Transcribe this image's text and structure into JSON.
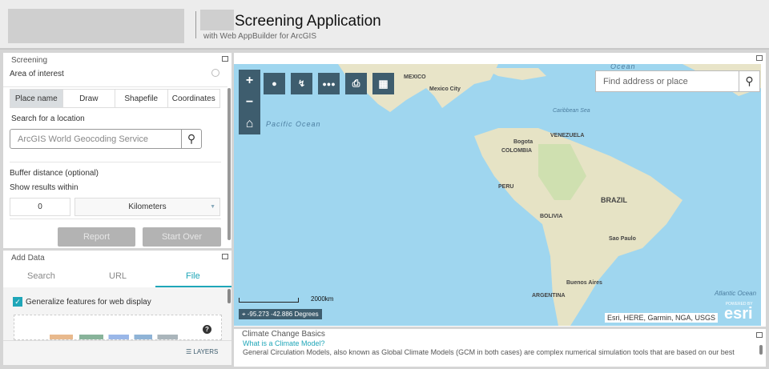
{
  "header": {
    "title": "Screening Application",
    "subtitle": "with Web AppBuilder for ArcGIS"
  },
  "screening": {
    "title": "Screening",
    "area_label": "Area of interest",
    "tabs": [
      "Place name",
      "Draw",
      "Shapefile",
      "Coordinates"
    ],
    "search_label": "Search for a location",
    "search_placeholder": "ArcGIS World Geocoding Service",
    "buffer_label": "Buffer distance (optional)",
    "within_label": "Show results within",
    "distance_value": "0",
    "unit": "Kilometers",
    "report": "Report",
    "start_over": "Start Over"
  },
  "add_data": {
    "title": "Add Data",
    "tabs": [
      "Search",
      "URL",
      "File"
    ],
    "generalize": "Generalize features for web display",
    "layers": "LAYERS"
  },
  "map": {
    "search_placeholder": "Find address or place",
    "scale": "2000km",
    "coords": "-95.273 -42.886 Degrees",
    "attribution": "Esri, HERE, Garmin, NGA, USGS",
    "powered": "POWERED BY",
    "esri": "esri",
    "labels": {
      "mexico": "MEXICO",
      "mexico_city": "Mexico City",
      "caribbean": "Caribbean Sea",
      "ocean_top": "Ocean",
      "venezuela": "VENEZUELA",
      "bogota": "Bogota",
      "colombia": "COLOMBIA",
      "peru": "PERU",
      "brazil": "BRAZIL",
      "bolivia": "BOLIVIA",
      "sao_paulo": "Sao Paulo",
      "buenos_aires": "Buenos Aires",
      "argentina": "ARGENTINA",
      "atlantic": "Atlantic Ocean",
      "pacific": "Pacific Ocean"
    }
  },
  "climate": {
    "title": "Climate Change Basics",
    "link": "What is a Climate Model?",
    "text": "General Circulation Models, also known as Global Climate Models (GCM in both cases) are complex numerical simulation tools that are based on our best"
  }
}
